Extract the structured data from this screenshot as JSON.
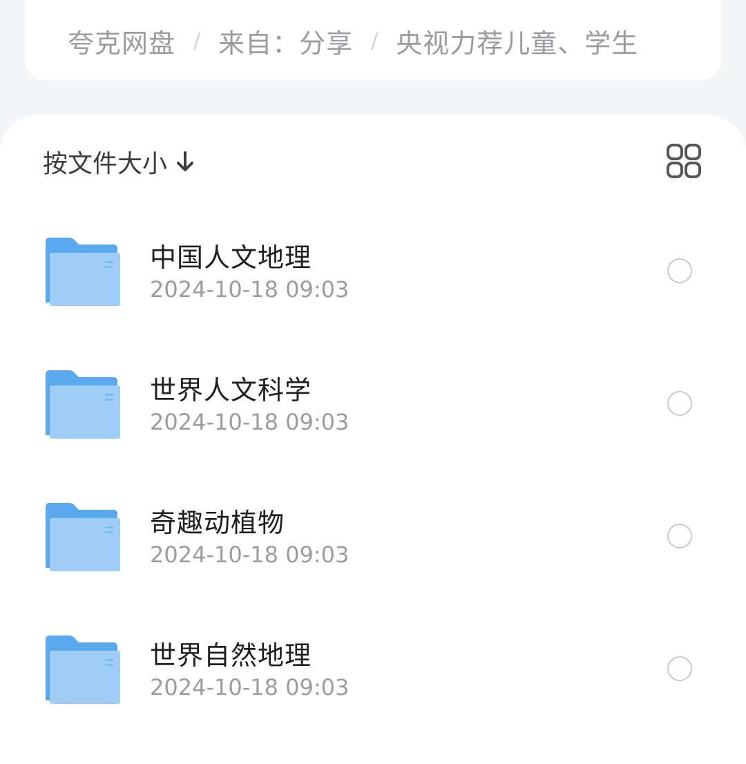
{
  "breadcrumb": {
    "items": [
      "夸克网盘",
      "来自：分享",
      "央视力荐儿童、学生"
    ],
    "separator": "/"
  },
  "toolbar": {
    "sort_label": "按文件大小",
    "sort_icon": "arrow-down-icon",
    "view_icon": "grid-view-icon"
  },
  "files": [
    {
      "name": "中国人文地理",
      "date": "2024-10-18 09:03",
      "icon": "folder-icon"
    },
    {
      "name": "世界人文科学",
      "date": "2024-10-18 09:03",
      "icon": "folder-icon"
    },
    {
      "name": "奇趣动植物",
      "date": "2024-10-18 09:03",
      "icon": "folder-icon"
    },
    {
      "name": "世界自然地理",
      "date": "2024-10-18 09:03",
      "icon": "folder-icon"
    }
  ],
  "colors": {
    "page_background": "#f4f5f6",
    "card_background": "#ffffff",
    "folder_back": "#5aa9ee",
    "folder_front": "#9fcff8",
    "text_primary": "#1e1f21",
    "text_secondary": "#9b9c9f"
  }
}
